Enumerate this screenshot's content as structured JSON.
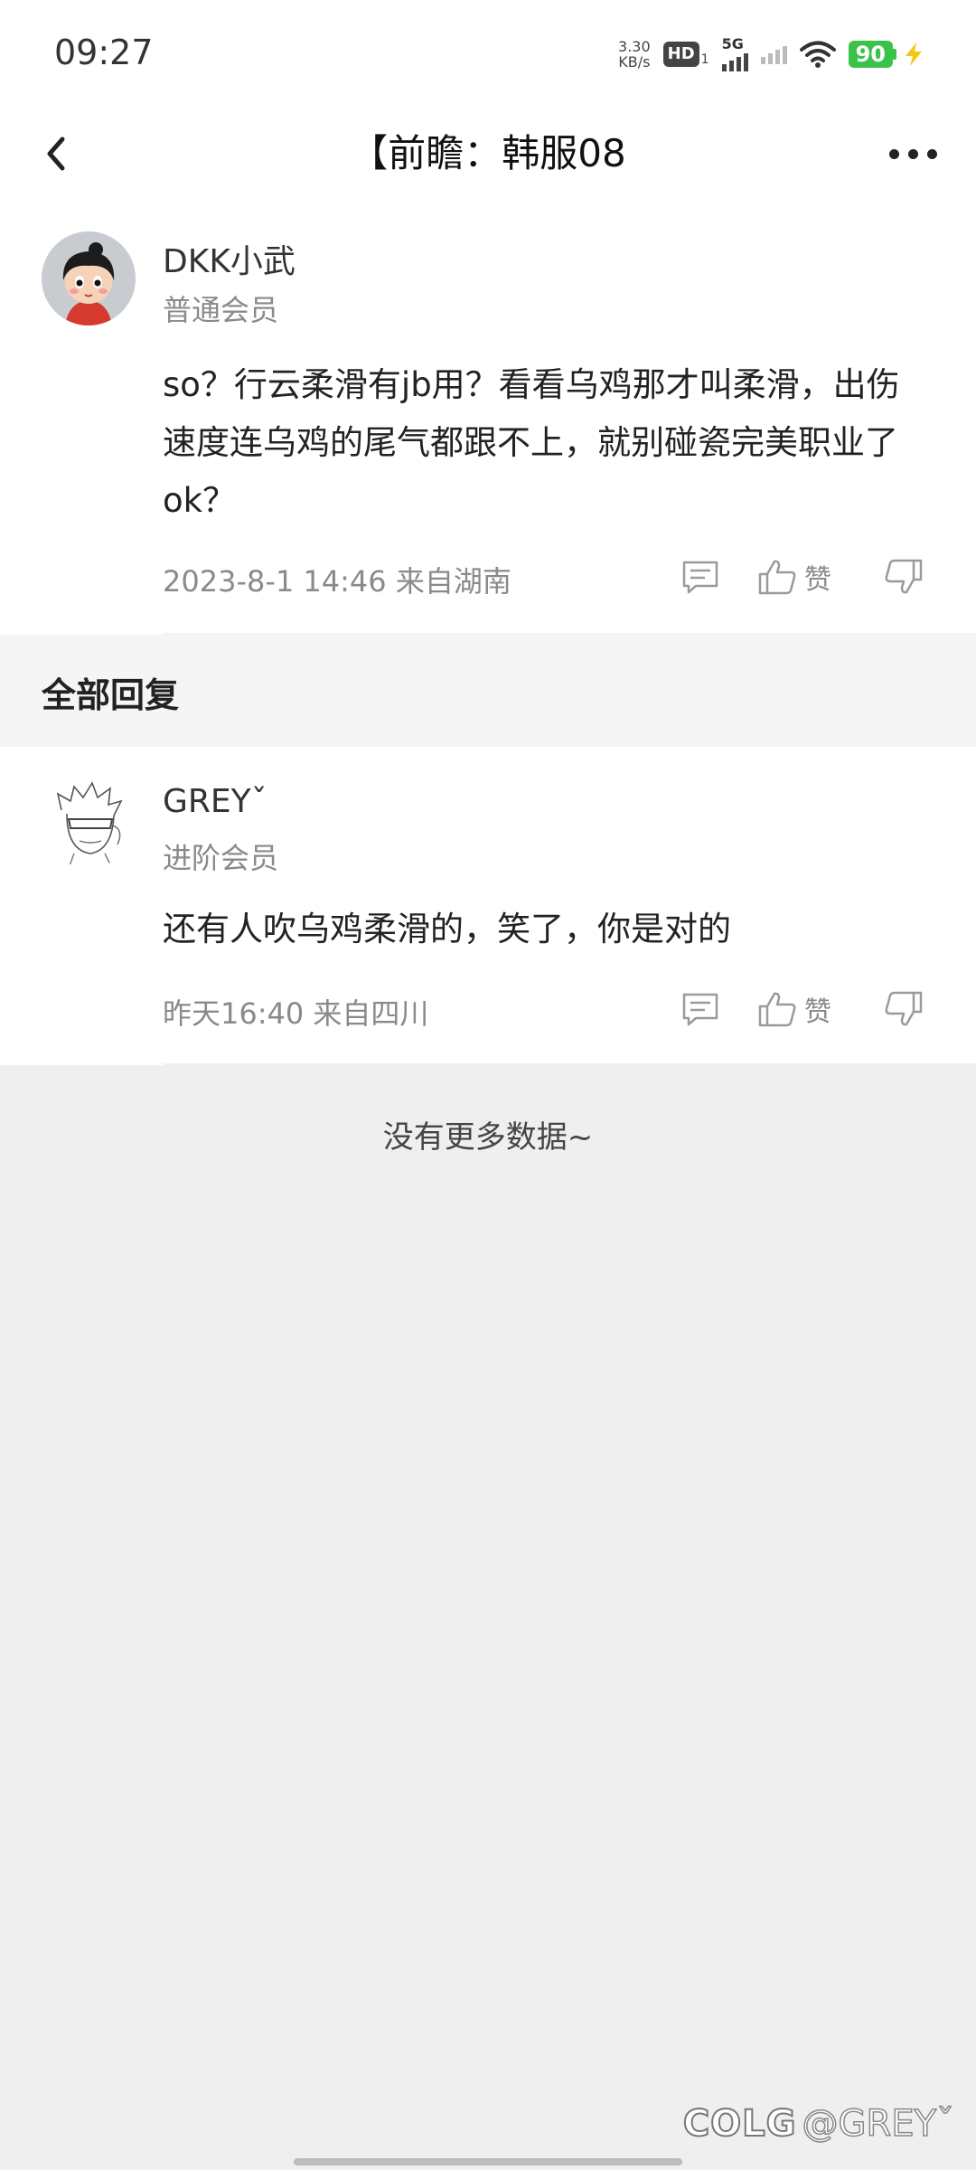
{
  "status_bar": {
    "time": "09:27",
    "net_speed_value": "3.30",
    "net_speed_unit": "KB/s",
    "hd_label": "HD",
    "hd_sub": "1",
    "signal_label": "5G",
    "battery_level": "90",
    "battery_color": "#3bc24a",
    "charging_icon": "bolt-icon"
  },
  "header": {
    "title": "【前瞻：韩服08",
    "back_icon": "chevron-left-icon",
    "more_icon": "more-dots-icon"
  },
  "main_comment": {
    "username": "DKK小武",
    "level": "普通会员",
    "text": "so？行云柔滑有jb用？看看乌鸡那才叫柔滑，出伤速度连乌鸡的尾气都跟不上，就别碰瓷完美职业了ok？",
    "meta": "2023-8-1 14:46  来自湖南",
    "like_label": "赞"
  },
  "section": {
    "title": "全部回复"
  },
  "replies": [
    {
      "username": "GREYˇ",
      "level": "进阶会员",
      "text": "还有人吹乌鸡柔滑的，笑了，你是对的",
      "meta": "昨天16:40 来自四川",
      "like_label": "赞"
    }
  ],
  "footer": {
    "no_more": "没有更多数据~",
    "watermark_logo": "COLG",
    "watermark_user": "@GREYˇ"
  }
}
